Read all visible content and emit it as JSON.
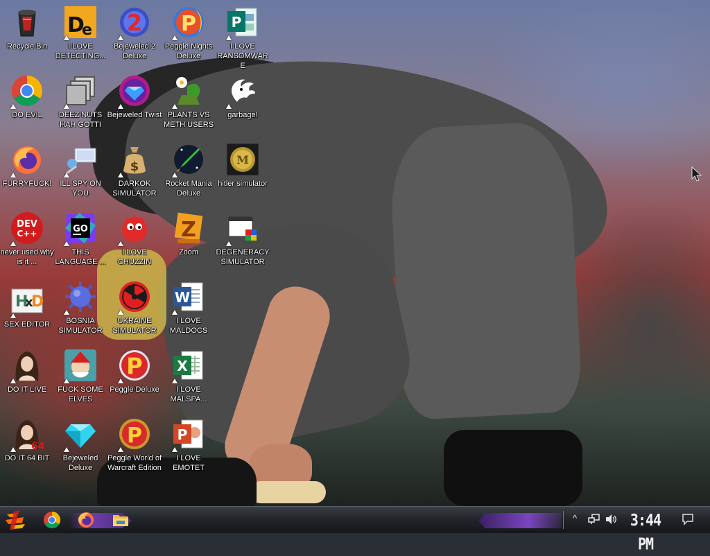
{
  "desktop": {
    "icons": [
      {
        "label": "Recycle Bin",
        "icon": "recycle-bin-icon",
        "shortcut": false
      },
      {
        "label": "I LOVE DETECTING...",
        "icon": "detect-it-easy-icon",
        "shortcut": true
      },
      {
        "label": "Bejeweled 2 Deluxe",
        "icon": "bejeweled-2-icon",
        "shortcut": true
      },
      {
        "label": "Peggle Nights Deluxe",
        "icon": "peggle-nights-icon",
        "shortcut": true
      },
      {
        "label": "I LOVE RANSOMWARE",
        "icon": "publisher-icon",
        "shortcut": true
      },
      {
        "label": "DO EVIL",
        "icon": "chrome-icon",
        "shortcut": true
      },
      {
        "label": "DEEZ NUTS HAH GOTTI",
        "icon": "copy-window-icon",
        "shortcut": true
      },
      {
        "label": "Bejeweled Twist",
        "icon": "bejeweled-twist-icon",
        "shortcut": true
      },
      {
        "label": "PLANTS VS METH USERS",
        "icon": "plants-vs-zombies-icon",
        "shortcut": true
      },
      {
        "label": "garbage!",
        "icon": "garbage-logo-icon",
        "shortcut": true
      },
      {
        "label": "FURRYFUCK!",
        "icon": "firefox-icon",
        "shortcut": true
      },
      {
        "label": "ILL SPY ON YOU",
        "icon": "remote-desktop-icon",
        "shortcut": true
      },
      {
        "label": "DARKOK SIMULATOR",
        "icon": "money-bag-icon",
        "shortcut": true
      },
      {
        "label": "Rocket Mania Deluxe",
        "icon": "rocket-mania-icon",
        "shortcut": true
      },
      {
        "label": "hitler simulator",
        "icon": "medal-icon",
        "shortcut": false
      },
      {
        "label": "never used why is it ...",
        "icon": "dev-cpp-icon",
        "shortcut": true
      },
      {
        "label": "THIS LANGUAGE ...",
        "icon": "goland-icon",
        "shortcut": true
      },
      {
        "label": "I LOVE CHUZZIN",
        "icon": "chuzzle-icon",
        "shortcut": true
      },
      {
        "label": "Zoom",
        "icon": "zuma-icon",
        "shortcut": false
      },
      {
        "label": "DEGENERACY SIMULATOR",
        "icon": "app-window-icon",
        "shortcut": true
      },
      {
        "label": "SEX EDITOR",
        "icon": "hxd-icon",
        "shortcut": true
      },
      {
        "label": "BOSNIA SIMULATOR",
        "icon": "spiked-mine-icon",
        "shortcut": true
      },
      {
        "label": "UKRAINE SIMULATOR",
        "icon": "radiation-icon",
        "shortcut": true
      },
      {
        "label": "I LOVE MALDOCS",
        "icon": "word-icon",
        "shortcut": true
      },
      {
        "label": "DO IT LIVE",
        "icon": "portrait-icon",
        "shortcut": true
      },
      {
        "label": "FUCK SOME ELVES",
        "icon": "elf-game-icon",
        "shortcut": true
      },
      {
        "label": "Peggle Deluxe",
        "icon": "peggle-icon",
        "shortcut": true
      },
      {
        "label": "I LOVE MALSPA...",
        "icon": "excel-icon",
        "shortcut": true
      },
      {
        "label": "DO IT 64 BIT",
        "icon": "portrait-64-icon",
        "shortcut": true
      },
      {
        "label": "Bejeweled Deluxe",
        "icon": "bejeweled-deluxe-icon",
        "shortcut": true
      },
      {
        "label": "Peggle World of Warcraft Edition",
        "icon": "peggle-wow-icon",
        "shortcut": true
      },
      {
        "label": "I LOVE EMOTET",
        "icon": "powerpoint-icon",
        "shortcut": true
      }
    ]
  },
  "taskbar": {
    "start": "start-button-icon",
    "pinned": [
      "chrome-icon",
      "firefox-icon",
      "file-explorer-icon"
    ],
    "tray": {
      "chevron": "^",
      "network": "network-icon",
      "volume": "volume-icon"
    },
    "clock": "3:44 PM",
    "notifications": "action-center-icon"
  },
  "colors": {
    "taskbar_accent": "#6b3da8",
    "label_text": "#ffffff"
  }
}
